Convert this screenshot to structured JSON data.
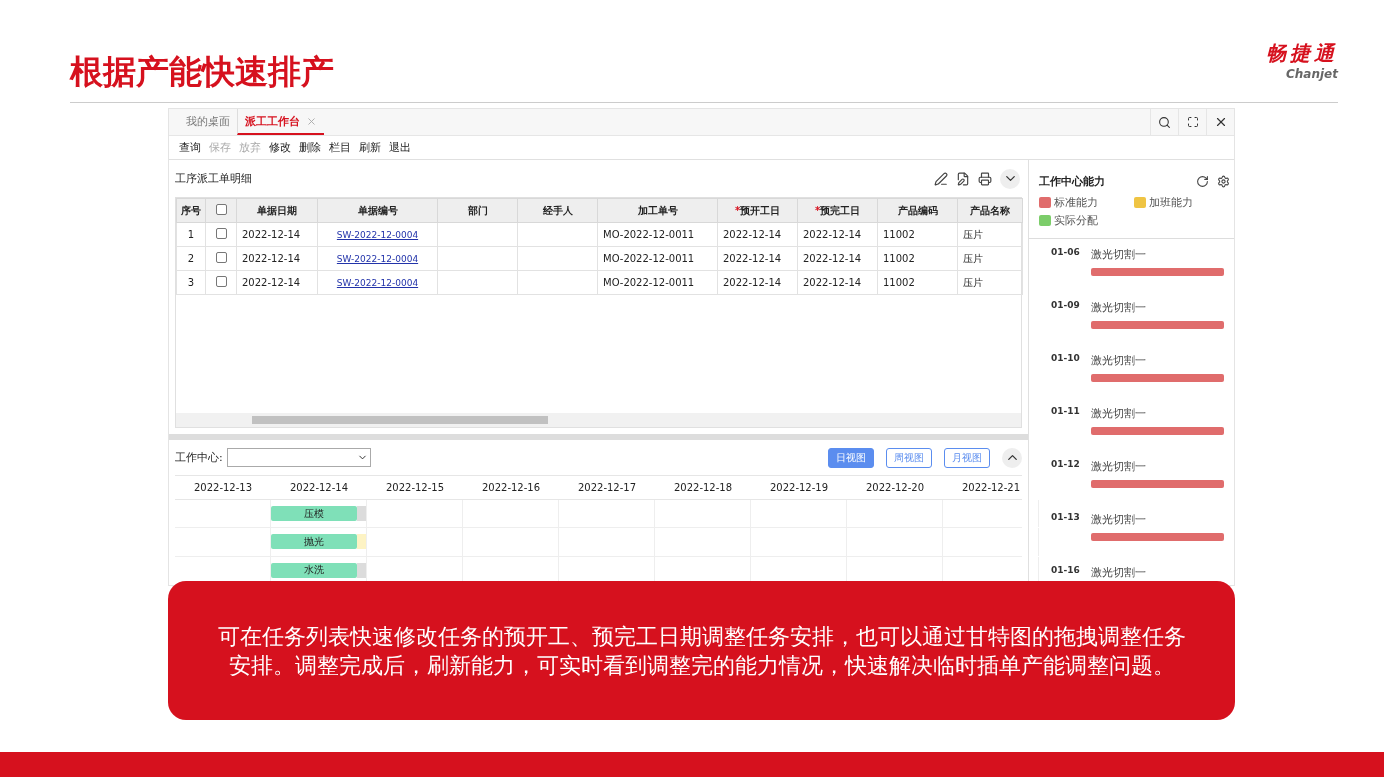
{
  "slide": {
    "title": "根据产能快速排产",
    "logo": {
      "name": "畅捷通",
      "subtitle": "Chanjet"
    }
  },
  "app": {
    "tabs": [
      {
        "label": "我的桌面",
        "selected": false,
        "closable": false
      },
      {
        "label": "派工工作台",
        "selected": true,
        "closable": true
      }
    ],
    "toolbar": [
      {
        "label": "查询",
        "disabled": false
      },
      {
        "label": "保存",
        "disabled": true
      },
      {
        "label": "放弃",
        "disabled": true
      },
      {
        "label": "修改",
        "disabled": false
      },
      {
        "label": "删除",
        "disabled": false
      },
      {
        "label": "栏目",
        "disabled": false
      },
      {
        "label": "刷新",
        "disabled": false
      },
      {
        "label": "退出",
        "disabled": false
      }
    ],
    "detail": {
      "title": "工序派工单明细",
      "columns": [
        {
          "label": "序号",
          "kind": "text"
        },
        {
          "kind": "check",
          "checked": false
        },
        {
          "label": "单据日期",
          "kind": "text"
        },
        {
          "label": "单据编号",
          "kind": "link"
        },
        {
          "label": "部门",
          "kind": "text"
        },
        {
          "label": "经手人",
          "kind": "text"
        },
        {
          "label": "加工单号",
          "kind": "text"
        },
        {
          "label": "预开工日",
          "kind": "text",
          "required_mark": "*"
        },
        {
          "label": "预完工日",
          "kind": "text",
          "required_mark": "*"
        },
        {
          "label": "产品编码",
          "kind": "text"
        },
        {
          "label": "产品名称",
          "kind": "text"
        }
      ],
      "rows": [
        {
          "checked": false,
          "cells": [
            "1",
            "",
            "2022-12-14",
            "SW-2022-12-0004",
            "",
            "",
            "MO-2022-12-0011",
            "2022-12-14",
            "2022-12-14",
            "11002",
            "压片"
          ]
        },
        {
          "checked": false,
          "cells": [
            "2",
            "",
            "2022-12-14",
            "SW-2022-12-0004",
            "",
            "",
            "MO-2022-12-0011",
            "2022-12-14",
            "2022-12-14",
            "11002",
            "压片"
          ]
        },
        {
          "checked": false,
          "cells": [
            "3",
            "",
            "2022-12-14",
            "SW-2022-12-0004",
            "",
            "",
            "MO-2022-12-0011",
            "2022-12-14",
            "2022-12-14",
            "11002",
            "压片"
          ]
        }
      ]
    },
    "gantt": {
      "filter_label": "工作中心:",
      "views": [
        {
          "label": "日视图",
          "selected": true
        },
        {
          "label": "周视图",
          "selected": false
        },
        {
          "label": "月视图",
          "selected": false
        }
      ],
      "dates": [
        "2022-12-13",
        "2022-12-14",
        "2022-12-15",
        "2022-12-16",
        "2022-12-17",
        "2022-12-18",
        "2022-12-19",
        "2022-12-20",
        "2022-12-21"
      ],
      "tasks": [
        {
          "label": "压模",
          "color": "#dcdcdc"
        },
        {
          "label": "抛光",
          "color": "#fdf3c4"
        },
        {
          "label": "水洗",
          "color": "#dcdcdc"
        }
      ]
    },
    "capacity": {
      "title": "工作中心能力",
      "legend": [
        {
          "label": "标准能力",
          "color": "#e06c6c"
        },
        {
          "label": "加班能力",
          "color": "#efc443"
        },
        {
          "label": "实际分配",
          "color": "#7ccd6a"
        }
      ],
      "items": [
        {
          "date": "01-06",
          "name": "激光切割一"
        },
        {
          "date": "01-09",
          "name": "激光切割一"
        },
        {
          "date": "01-10",
          "name": "激光切割一"
        },
        {
          "date": "01-11",
          "name": "激光切割一"
        },
        {
          "date": "01-12",
          "name": "激光切割一"
        },
        {
          "date": "01-13",
          "name": "激光切割一"
        },
        {
          "date": "01-16",
          "name": "激光切割一"
        }
      ]
    }
  },
  "callout": "可在任务列表快速修改任务的预开工、预完工日期调整任务安排，也可以通过甘特图的拖拽调整任务安排。调整完成后，刷新能力，可实时看到调整完的能力情况，快速解决临时插单产能调整问题。"
}
